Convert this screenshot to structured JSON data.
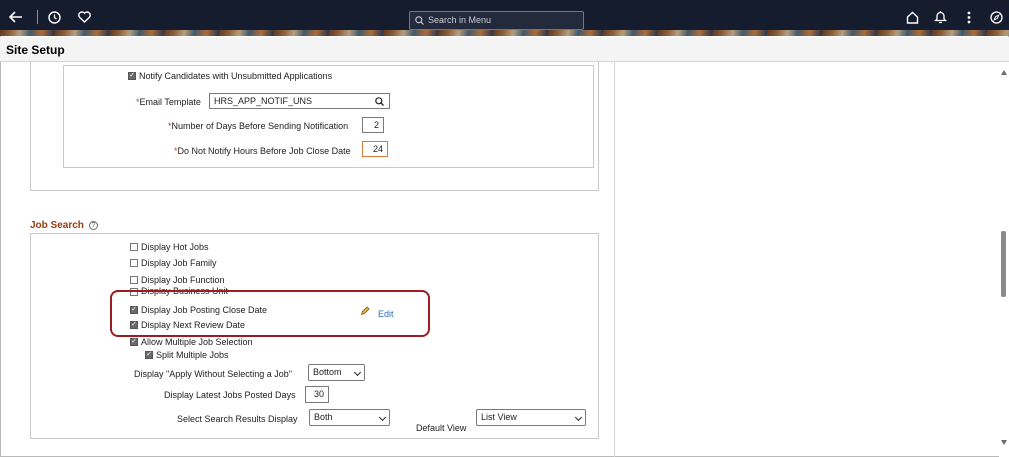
{
  "topbar": {
    "search_placeholder": "Search in Menu",
    "icons": [
      "back-arrow-icon",
      "history-icon",
      "favorites-icon",
      "home-icon",
      "notifications-icon",
      "more-icon",
      "navigator-icon"
    ]
  },
  "header": {
    "title": "Site Setup"
  },
  "notify": {
    "checkbox_label": "Notify Candidates with Unsubmitted Applications",
    "checked": true,
    "email_template_label": "Email Template",
    "email_template_value": "HRS_APP_NOTIF_UNS",
    "days_label": "Number of Days Before Sending Notification",
    "days_value": "2",
    "hours_label": "Do Not Notify Hours Before Job Close Date",
    "hours_value": "24",
    "required_mark": "*"
  },
  "job_search": {
    "title": "Job Search",
    "help_glyph": "?",
    "options": [
      {
        "label": "Display Hot Jobs",
        "checked": false
      },
      {
        "label": "Display Job Family",
        "checked": false
      },
      {
        "label": "Display Job Function",
        "checked": false
      },
      {
        "label": "Display Business Unit",
        "checked": false
      },
      {
        "label": "Display Job Posting Close Date",
        "checked": true
      },
      {
        "label": "Display Next Review Date",
        "checked": true
      },
      {
        "label": "Allow Multiple Job Selection",
        "checked": true
      }
    ],
    "split": {
      "label": "Split Multiple Jobs",
      "checked": true
    },
    "edit_label": "Edit",
    "apply_label": "Display \"Apply Without Selecting a Job\"",
    "apply_value": "Bottom",
    "latest_label": "Display Latest Jobs Posted Days",
    "latest_value": "30",
    "results_label": "Select Search Results Display",
    "results_value": "Both",
    "default_view_label": "Default View",
    "default_view_value": "List View"
  },
  "colors": {
    "topbar": "#151c2e",
    "section_title": "#9a3b12",
    "highlight": "#9b1c22",
    "link": "#2a6ebb"
  }
}
